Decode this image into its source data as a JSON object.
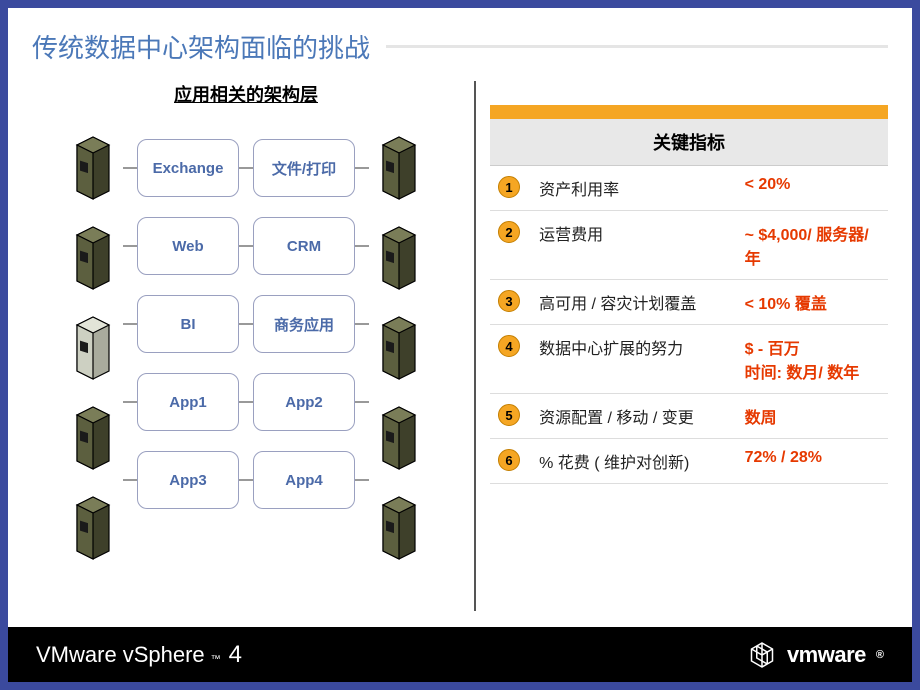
{
  "title": "传统数据中心架构面临的挑战",
  "sub_title": "应用相关的架构层",
  "apps": [
    {
      "left": "Exchange",
      "right": "文件/打印"
    },
    {
      "left": "Web",
      "right": "CRM"
    },
    {
      "left": "BI",
      "right": "商务应用"
    },
    {
      "left": "App1",
      "right": "App2"
    },
    {
      "left": "App3",
      "right": "App4"
    }
  ],
  "metrics": {
    "header": "关键指标",
    "rows": [
      {
        "num": "1",
        "label": "资产利用率",
        "value": "< 20%"
      },
      {
        "num": "2",
        "label": "运营费用",
        "value": "~ $4,000/ 服务器/年"
      },
      {
        "num": "3",
        "label": "高可用 / 容灾计划覆盖",
        "value": "< 10% 覆盖"
      },
      {
        "num": "4",
        "label": "数据中心扩展的努力",
        "value": "$ - 百万\n时间: 数月/ 数年"
      },
      {
        "num": "5",
        "label": "资源配置 / 移动 / 变更",
        "value": "数周"
      },
      {
        "num": "6",
        "label": "% 花费 ( 维护对创新)",
        "value": "72% / 28%"
      }
    ]
  },
  "footer": {
    "product_vm": "VMware",
    "product_sphere": "vSphere",
    "product_version": "4",
    "brand": "vmware"
  },
  "servers": {
    "left": [
      "dark",
      "dark",
      "light",
      "dark",
      "dark"
    ],
    "right": [
      "dark",
      "dark",
      "dark",
      "dark",
      "dark"
    ]
  }
}
